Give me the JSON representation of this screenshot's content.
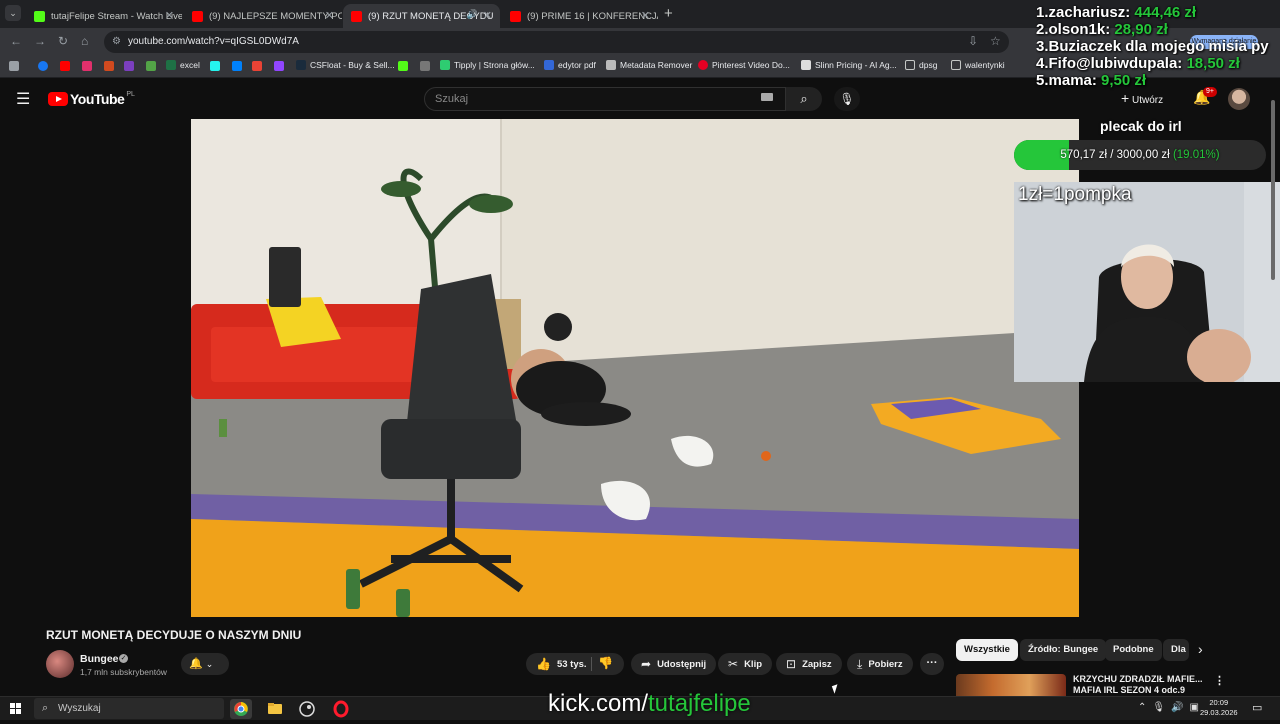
{
  "browser": {
    "tabs": [
      {
        "title": "tutajFelipe Stream - Watch Live",
        "icon": "kick-icon",
        "color": "#53fc18",
        "active": false
      },
      {
        "title": "(9) NAJLEPSZE MOMENTY POL",
        "icon": "youtube-icon",
        "color": "#ff0000",
        "active": false
      },
      {
        "title": "(9) RZUT MONETĄ DECYDU",
        "icon": "youtube-icon",
        "color": "#ff0000",
        "active": true
      },
      {
        "title": "(9) PRIME 16 | KONFERENCJA ⚡",
        "icon": "youtube-icon",
        "color": "#ff0000",
        "active": false
      }
    ],
    "url": "youtube.com/watch?v=qIGSL0DWd7A",
    "bookmarks": [
      {
        "label": "excel"
      },
      {
        "label": "CSFloat - Buy & Sell..."
      },
      {
        "label": "Tipply | Strona głów..."
      },
      {
        "label": "edytor pdf"
      },
      {
        "label": "Metadata Remover"
      },
      {
        "label": "Pinterest Video Do..."
      },
      {
        "label": "Slinn Pricing - AI Ag..."
      },
      {
        "label": "dpsg"
      },
      {
        "label": "walentynki"
      }
    ],
    "action_label": "Wymagane działanie"
  },
  "youtube": {
    "logo_text": "YouTube",
    "region": "PL",
    "search_placeholder": "Szukaj",
    "create_label": "Utwórz",
    "notif_count": "9+",
    "video_title": "RZUT MONETĄ DECYDUJE O NASZYM DNIU",
    "channel_name": "Bungee",
    "channel_subs": "1,7 mln subskrybentów",
    "likes": "53 tys.",
    "share_label": "Udostępnij",
    "clip_label": "Klip",
    "save_label": "Zapisz",
    "download_label": "Pobierz",
    "chips": [
      "Wszystkie",
      "Źródło: Bungee",
      "Podobne",
      "Dla"
    ],
    "related": {
      "title": "KRZYCHU ZDRADZIŁ MAFIE... MAFIA IRL SEZON 4 odc.9"
    }
  },
  "overlay": {
    "donors": [
      {
        "rank": "1.",
        "name": "zachariusz:",
        "amount": "444,46 zł"
      },
      {
        "rank": "2.",
        "name": "olson1k:",
        "amount": "28,90 zł"
      },
      {
        "rank": "3.",
        "name": "Buziaczek dla mojego misia py",
        "amount": ""
      },
      {
        "rank": "4.",
        "name": "Fifo@lubiwdupala:",
        "amount": "18,50 zł"
      },
      {
        "rank": "5.",
        "name": "mama:",
        "amount": "9,50 zł"
      }
    ],
    "goal_title": "plecak do irl",
    "goal_amount": "570,17 zł / 3000,00 zł",
    "goal_percent": "(19.01%)",
    "goal_fraction": 0.1901,
    "cam_label": "1zł=1pompka",
    "kick_prefix": "kick.com/",
    "kick_name": "tutajfelipe"
  },
  "taskbar": {
    "search_placeholder": "Wyszukaj",
    "time": "20:09",
    "date": "29.03.2026"
  },
  "colors": {
    "accent_green": "#25c63a",
    "youtube_red": "#ff0000"
  }
}
